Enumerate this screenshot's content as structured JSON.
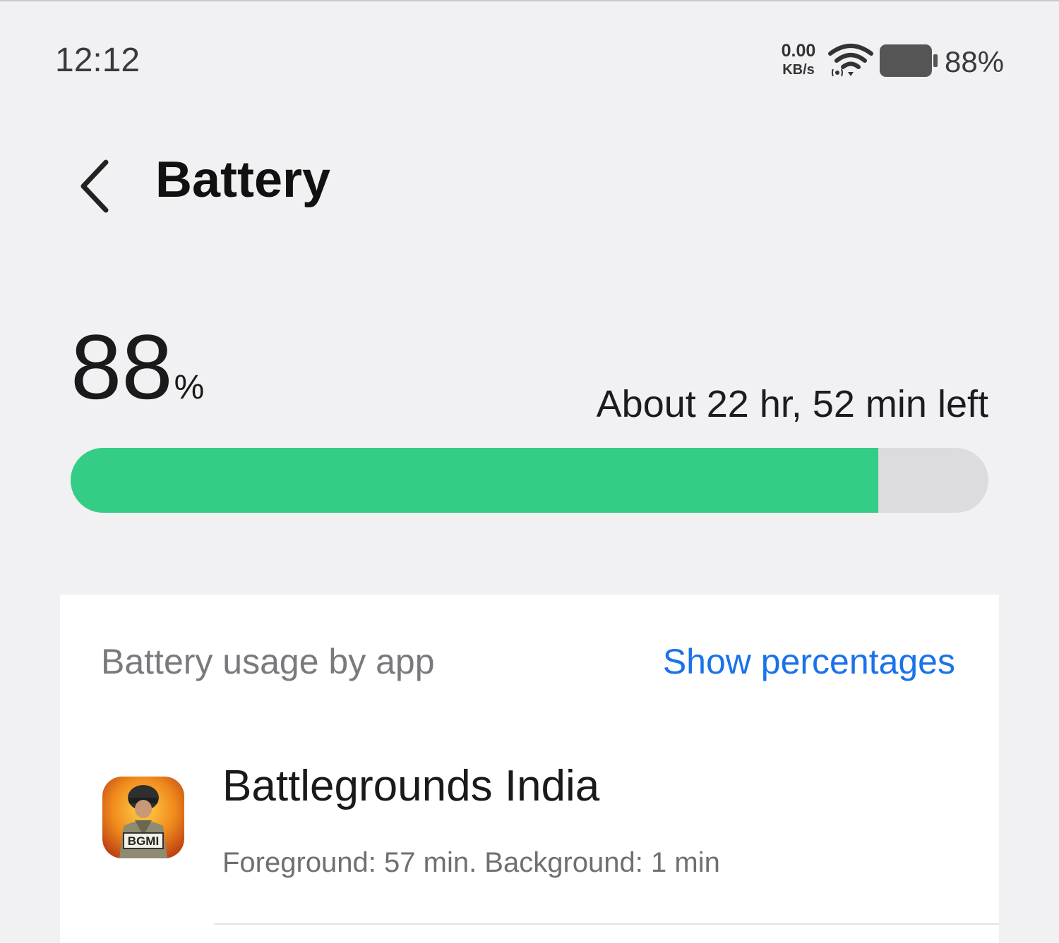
{
  "status_bar": {
    "time": "12:12",
    "net_speed_value": "0.00",
    "net_speed_unit": "KB/s",
    "battery_percent": "88%",
    "icons": [
      "wifi-icon",
      "battery-icon"
    ]
  },
  "header": {
    "title": "Battery",
    "back_icon": "back-chevron-icon"
  },
  "battery": {
    "level": "88",
    "level_unit": "%",
    "level_fraction": 0.88,
    "time_left": "About 22 hr, 52 min left",
    "bar_color": "#33cd86"
  },
  "usage": {
    "header": "Battery usage by app",
    "show_percentages": "Show percentages",
    "accent_color": "#1a73e8",
    "apps": [
      {
        "name": "Battlegrounds India",
        "usage": "Foreground: 57 min. Background: 1 min",
        "icon": "bgmi-app-icon",
        "icon_label": "BGMI"
      }
    ]
  }
}
